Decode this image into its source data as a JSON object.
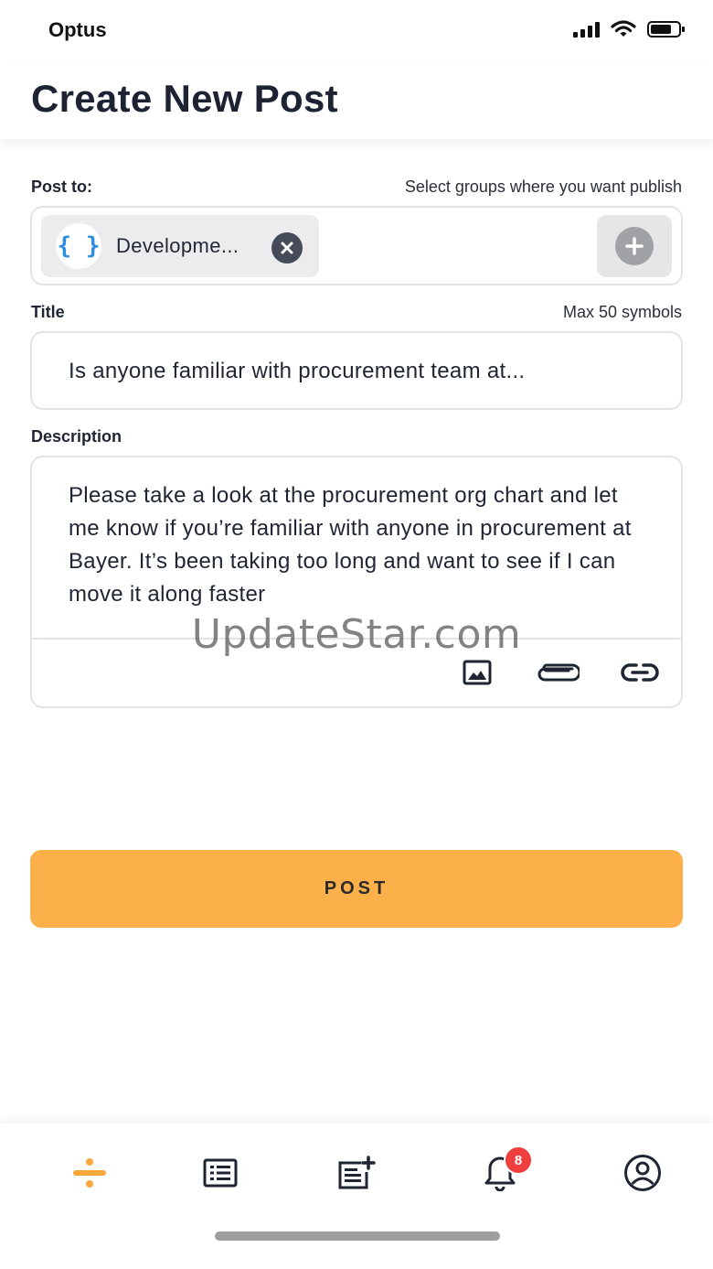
{
  "status_bar": {
    "carrier": "Optus",
    "icons": [
      "signal-icon",
      "wifi-icon",
      "battery-icon"
    ]
  },
  "header": {
    "title": "Create New Post"
  },
  "post_to": {
    "label": "Post to:",
    "hint": "Select groups where you want publish",
    "selected_groups": [
      {
        "label": "Developme...",
        "avatar_text": "{ }",
        "icon": "code-braces-icon"
      }
    ],
    "add_icon": "plus-circle-icon"
  },
  "title_field": {
    "label": "Title",
    "hint": "Max 50 symbols",
    "value": "Is anyone familiar with procurement team at..."
  },
  "description_field": {
    "label": "Description",
    "value": "Please take a look at the procurement org chart and let me know if you’re familiar with anyone in procurement at Bayer. It’s been taking too long and want to see if I can move it along faster",
    "toolbar_icons": [
      "image-icon",
      "paperclip-icon",
      "link-icon"
    ]
  },
  "watermark": "UpdateStar.com",
  "post_button": {
    "label": "POST"
  },
  "bottom_nav": {
    "items": [
      {
        "icon": "divide-icon",
        "active": true
      },
      {
        "icon": "list-icon",
        "active": false
      },
      {
        "icon": "new-post-icon",
        "active": false
      },
      {
        "icon": "bell-icon",
        "active": false,
        "badge": "8"
      },
      {
        "icon": "profile-icon",
        "active": false
      }
    ]
  },
  "colors": {
    "accent": "#fcb049",
    "active_nav": "#f9a83c",
    "badge": "#ef3e3e",
    "title_text": "#1d2333"
  }
}
